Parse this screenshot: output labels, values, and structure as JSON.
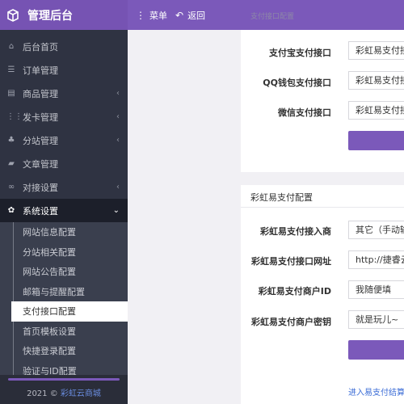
{
  "header": {
    "app_title": "管理后台",
    "menu_label": "菜单",
    "back_label": "返回"
  },
  "sidebar": {
    "items": [
      {
        "label": "后台首页",
        "icon": "home-icon"
      },
      {
        "label": "订单管理",
        "icon": "list-icon"
      },
      {
        "label": "商品管理",
        "icon": "cart-icon"
      },
      {
        "label": "发卡管理",
        "icon": "grid-icon"
      },
      {
        "label": "分站管理",
        "icon": "sitemap-icon"
      },
      {
        "label": "文章管理",
        "icon": "article-icon"
      },
      {
        "label": "对接设置",
        "icon": "link-icon"
      },
      {
        "label": "系统设置",
        "icon": "gear-icon"
      }
    ],
    "subitems": [
      {
        "label": "网站信息配置"
      },
      {
        "label": "分站相关配置"
      },
      {
        "label": "网站公告配置"
      },
      {
        "label": "邮箱与提醒配置"
      },
      {
        "label": "支付接口配置"
      },
      {
        "label": "首页模板设置"
      },
      {
        "label": "快捷登录配置"
      },
      {
        "label": "验证与ID配置"
      }
    ],
    "footer": {
      "year": "2021 ©",
      "brand": "彩虹云商城"
    }
  },
  "panel1": {
    "title": "支付接口配置",
    "rows": [
      {
        "label": "支付宝支付接口",
        "value": "彩虹易支付接"
      },
      {
        "label": "QQ钱包支付接口",
        "value": "彩虹易支付接"
      },
      {
        "label": "微信支付接口",
        "value": "彩虹易支付接"
      }
    ]
  },
  "panel2": {
    "title": "彩虹易支付配置",
    "rows": [
      {
        "label": "彩虹易支付接入商",
        "value": "其它（手动输"
      },
      {
        "label": "彩虹易支付接口网址",
        "value": "http://捷睿云上"
      },
      {
        "label": "彩虹易支付商户ID",
        "value": "我随便填"
      },
      {
        "label": "彩虹易支付商户密钥",
        "value": "就是玩儿~"
      }
    ],
    "link": "进入易支付结算"
  },
  "colors": {
    "brand": "#7b59ba",
    "sidebar": "#2f3342",
    "link": "#3b6cd6"
  }
}
